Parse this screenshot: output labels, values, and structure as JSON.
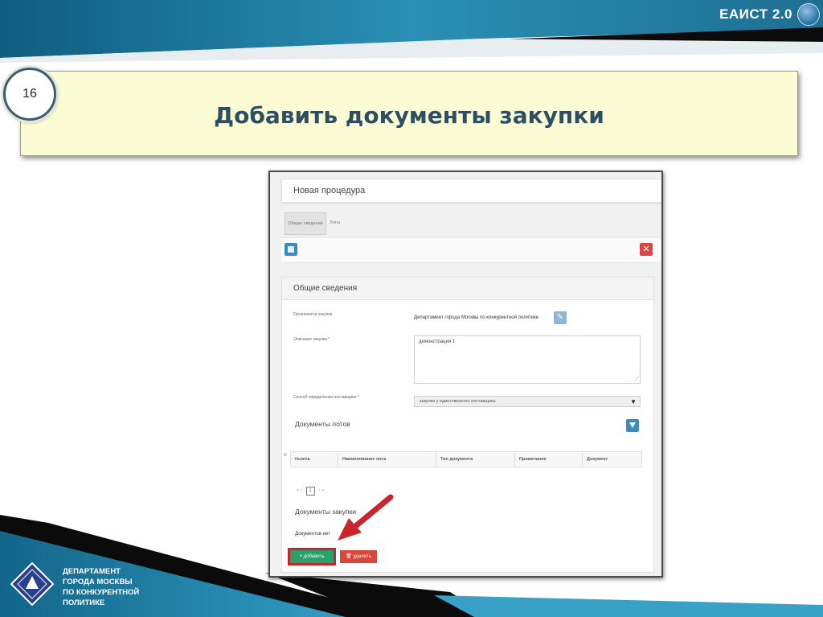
{
  "brand": {
    "name": "ЕАИСТ 2.0"
  },
  "slide": {
    "number": "16",
    "title": "Добавить документы закупки"
  },
  "department": {
    "lines": [
      "ДЕПАРТАМЕНТ",
      "ГОРОДА МОСКВЫ",
      "ПО КОНКУРЕНТНОЙ",
      "ПОЛИТИКЕ"
    ]
  },
  "app": {
    "header": "Новая процедура",
    "tabs": [
      {
        "label": "Общие сведения",
        "active": true
      },
      {
        "label": "Лоты",
        "active": false
      }
    ],
    "toolbar": {
      "save_icon": "save-icon",
      "close_label": "✕"
    },
    "section": {
      "title": "Общие сведения",
      "organizer_label": "Организатор закупки",
      "organizer_value": "Департамент города Москвы по конкурентной политике",
      "description_label": "Описание закупки",
      "description_value": "демонстрация 1",
      "method_label": "Способ определения поставщика",
      "method_value": "закупки у единственного поставщика",
      "required_mark": "*",
      "lot_docs_title": "Документы лотов",
      "table_headers": [
        "№лота",
        "Наименование лота",
        "Тип документа",
        "Примечание",
        "Документ"
      ],
      "row_marker": "≡",
      "pager": {
        "prev_first": "«",
        "prev": "‹",
        "current": "1",
        "next": "›",
        "last": "»"
      },
      "purchase_docs_title": "Документы закупки",
      "no_docs": "Документов нет",
      "add_label": "+ добавить",
      "delete_label": "удалить"
    }
  },
  "colors": {
    "accent_blue": "#3b8bbd",
    "add_green": "#2aa06a",
    "delete_red": "#d9473c",
    "highlight_red": "#c8262c",
    "title_banner": "#fbfcd4",
    "title_text": "#2e4f62"
  }
}
